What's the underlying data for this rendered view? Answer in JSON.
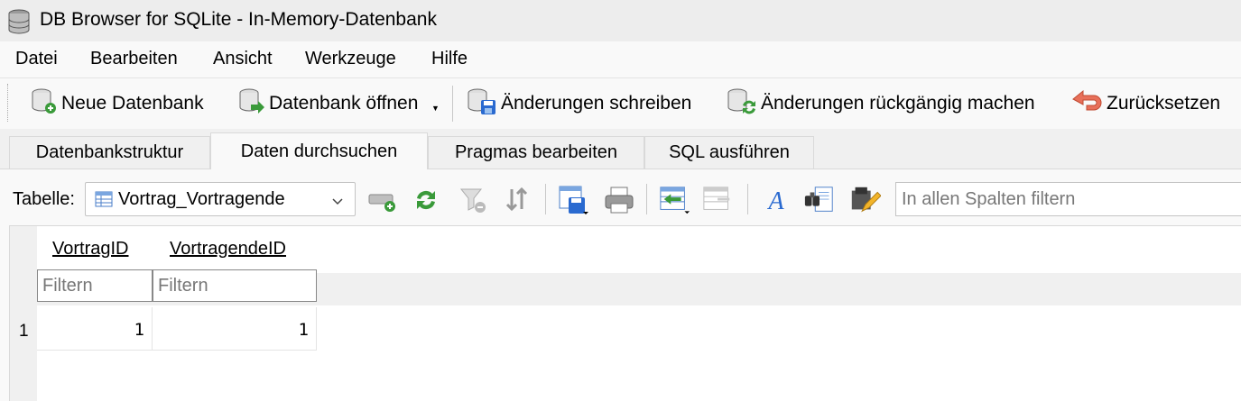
{
  "window": {
    "title": "DB Browser for SQLite - In-Memory-Datenbank",
    "icon": "database-icon"
  },
  "menu": [
    "Datei",
    "Bearbeiten",
    "Ansicht",
    "Werkzeuge",
    "Hilfe"
  ],
  "toolbar": {
    "new_db": "Neue Datenbank",
    "open_db": "Datenbank öffnen",
    "write_changes": "Änderungen schreiben",
    "revert_changes": "Änderungen rückgängig machen",
    "reset": "Zurücksetzen"
  },
  "tabs": [
    "Datenbankstruktur",
    "Daten durchsuchen",
    "Pragmas bearbeiten",
    "SQL ausführen"
  ],
  "active_tab": "Daten durchsuchen",
  "browse": {
    "table_label": "Tabelle:",
    "selected_table": "Vortrag_Vortragende",
    "global_filter_placeholder": "In allen Spalten filtern",
    "icons": [
      "new-record-icon",
      "refresh-icon",
      "clear-filter-icon",
      "sort-icon",
      "save-table-icon",
      "print-icon",
      "insert-values-icon",
      "delete-record-icon",
      "font-icon",
      "find-icon",
      "edit-cell-icon"
    ]
  },
  "grid": {
    "columns": [
      "VortragID",
      "VortragendeID"
    ],
    "filter_placeholder": "Filtern",
    "rows": [
      {
        "num": "1",
        "cells": [
          "1",
          "1"
        ]
      }
    ]
  },
  "colors": {
    "accent_green": "#3a9a3a",
    "accent_blue": "#2a6ad0",
    "reset_red": "#e05030"
  }
}
